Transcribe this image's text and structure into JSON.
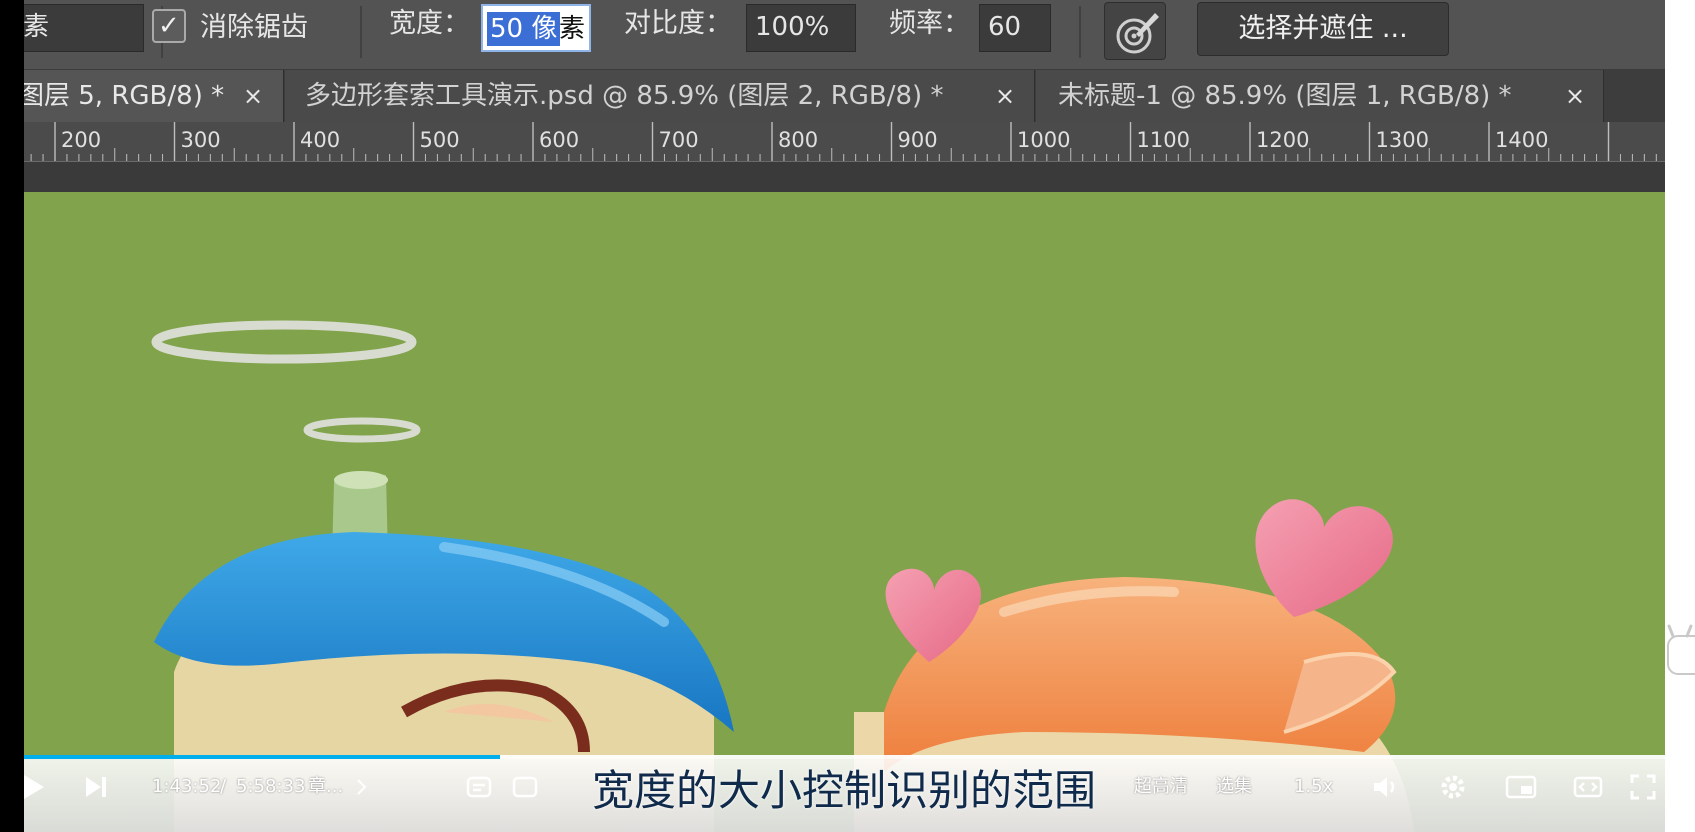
{
  "options_bar": {
    "left_field_text": "素",
    "antialias_label": "消除锯齿",
    "width_label": "宽度：",
    "width_value_selected": "50 像",
    "width_value_rest": "素",
    "contrast_label": "对比度：",
    "contrast_value": "100%",
    "frequency_label": "频率：",
    "frequency_value": "60",
    "pen_pressure_icon": "pen-pressure-icon",
    "select_mask_label": "选择并遮住 ..."
  },
  "tabs": [
    {
      "label": "图层 5, RGB/8) *",
      "close": "×"
    },
    {
      "label": "多边形套索工具演示.psd @ 85.9% (图层 2, RGB/8) *",
      "close": "×"
    },
    {
      "label": "未标题-1 @ 85.9% (图层 1, RGB/8) *",
      "close": "×"
    }
  ],
  "ruler": {
    "labels": [
      "200",
      "300",
      "400",
      "500",
      "600",
      "700",
      "800",
      "900",
      "1000",
      "1100",
      "1200",
      "1300",
      "1400"
    ]
  },
  "player": {
    "current_time": "1:43:52",
    "separator": "/",
    "total_time": "5:58:33",
    "chapter": "章...",
    "quality": "超高清",
    "playlist": "选集",
    "speed": "1.5x",
    "progress_fraction": 0.29,
    "accent_color": "#00aeec"
  },
  "subtitle": "宽度的大小控制识别的范围",
  "colors": {
    "canvas_green": "#81a34b",
    "ui_dark": "#535353"
  }
}
